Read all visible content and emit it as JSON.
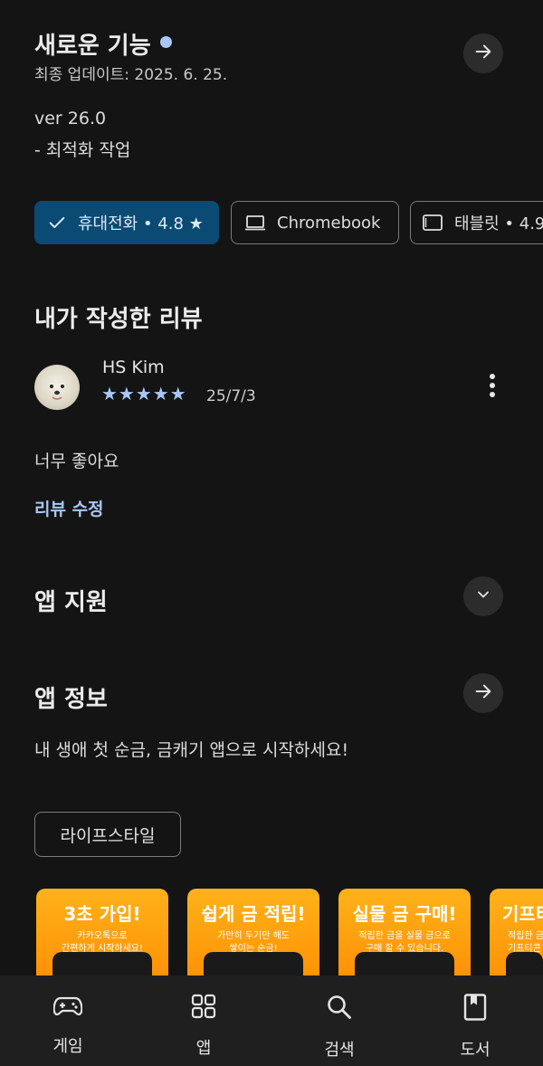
{
  "whats_new": {
    "title": "새로운 기능",
    "updated": "최종 업데이트: 2025. 6. 25.",
    "version": "ver 26.0",
    "note": "- 최적화 작업"
  },
  "device_chips": [
    {
      "label": "휴대전화 • 4.8 ★",
      "selected": true
    },
    {
      "label": "Chromebook",
      "selected": false
    },
    {
      "label": "태블릿 • 4.9",
      "selected": false
    }
  ],
  "my_review": {
    "heading": "내가 작성한 리뷰",
    "user": "HS Kim",
    "stars": "★★★★★",
    "rating": 5,
    "date": "25/7/3",
    "text": "너무 좋아요",
    "edit_label": "리뷰 수정"
  },
  "app_support": {
    "heading": "앱 지원"
  },
  "app_info": {
    "heading": "앱 정보",
    "description": "내 생애 첫 순금, 금캐기 앱으로 시작하세요!",
    "category": "라이프스타일"
  },
  "screenshots": [
    {
      "title": "3초 가입!",
      "desc1": "카카오톡으로",
      "desc2": "간편하게 시작하세요!"
    },
    {
      "title": "쉽게 금 적립!",
      "desc1": "가만히 두기만 해도",
      "desc2": "쌓이는 순금!"
    },
    {
      "title": "실물 금 구매!",
      "desc1": "적립한 금을 실물 금으로",
      "desc2": "구매 할 수 있습니다."
    },
    {
      "title": "기프티",
      "desc1": "적립한 금",
      "desc2": "기프티콘"
    }
  ],
  "bottom_nav": [
    {
      "label": "게임",
      "icon": "gamepad-icon"
    },
    {
      "label": "앱",
      "icon": "apps-grid-icon"
    },
    {
      "label": "검색",
      "icon": "search-icon"
    },
    {
      "label": "도서",
      "icon": "book-icon"
    }
  ],
  "colors": {
    "accent": "#a9c7f5",
    "chip_selected": "#0a4a73",
    "new_dot": "#a9c7f5"
  }
}
